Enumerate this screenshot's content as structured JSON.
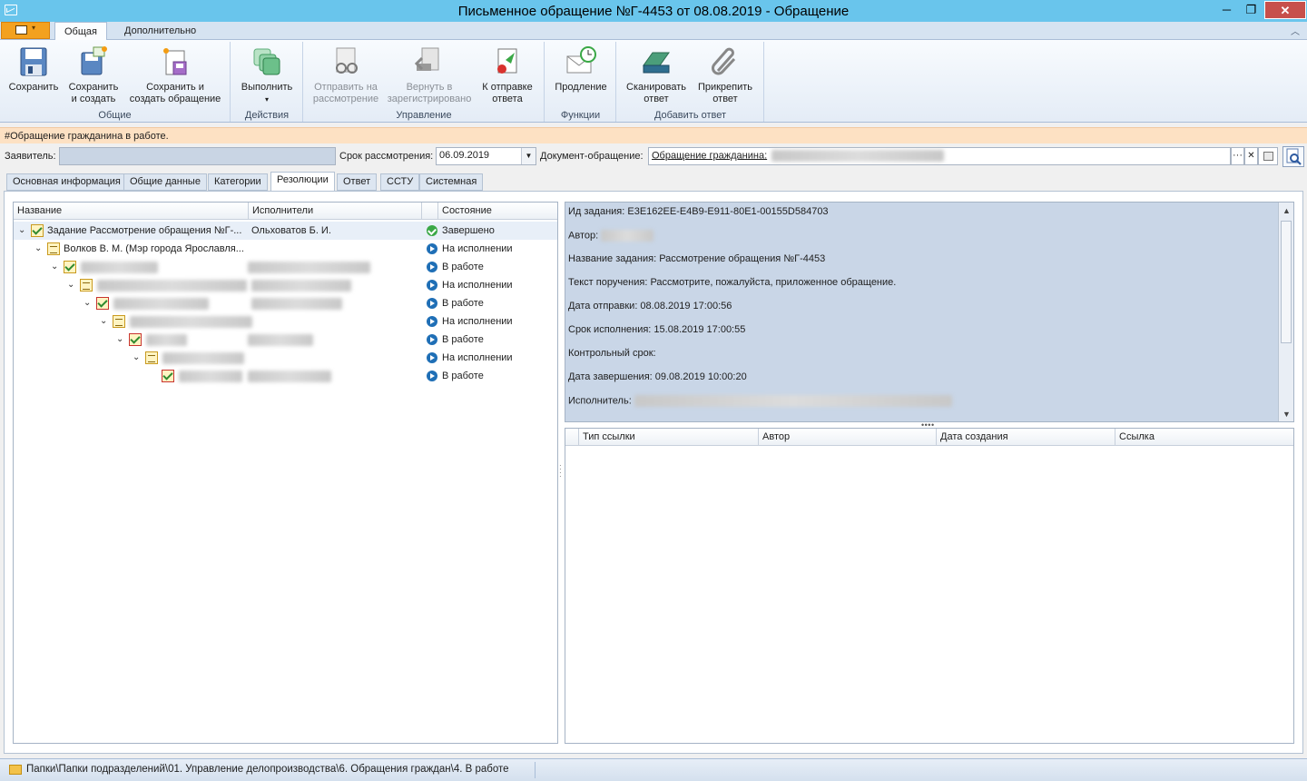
{
  "window": {
    "title": "Письменное обращение №Г-4453 от 08.08.2019 - Обращение",
    "minimize": "─",
    "maximize": "❐",
    "close": "✕"
  },
  "ribbon_tabs": [
    "Общая",
    "Дополнительно"
  ],
  "ribbon": {
    "groups": {
      "common": "Общие",
      "actions": "Действия",
      "management": "Управление",
      "functions": "Функции",
      "add_answer": "Добавить ответ"
    },
    "buttons": {
      "save": "Сохранить",
      "save_create_1": "Сохранить",
      "save_create_2": "и создать",
      "save_create_req_1": "Сохранить и",
      "save_create_req_2": "создать обращение",
      "execute": "Выполнить",
      "send_review_1": "Отправить на",
      "send_review_2": "рассмотрение",
      "return_1": "Вернуть в",
      "return_2": "зарегистрировано",
      "to_send_1": "К отправке",
      "to_send_2": "ответа",
      "extend": "Продление",
      "scan_1": "Сканировать",
      "scan_2": "ответ",
      "attach_1": "Прикрепить",
      "attach_2": "ответ"
    }
  },
  "infobar": "#Обращение гражданина в работе.",
  "fields": {
    "applicant_label": "Заявитель:",
    "deadline_label": "Срок рассмотрения:",
    "deadline_value": "06.09.2019",
    "doc_label": "Документ-обращение:",
    "doc_value": "Обращение гражданина:"
  },
  "doc_tabs": [
    "Основная информация",
    "Общие данные",
    "Категории",
    "Резолюции",
    "Ответ",
    "ССТУ",
    "Системная"
  ],
  "tree": {
    "columns": [
      "Название",
      "Исполнители",
      "Состояние"
    ],
    "rows": [
      {
        "name": "Задание Рассмотрение обращения №Г-...",
        "exec": "Ольховатов Б. И.",
        "status": "Завершено"
      },
      {
        "name": "Волков В. М. (Мэр города Ярославля...",
        "exec": "",
        "status": "На исполнении"
      },
      {
        "name": "",
        "exec": "",
        "status": "В работе"
      },
      {
        "name": "",
        "exec": "",
        "status": "На исполнении"
      },
      {
        "name": "",
        "exec": "",
        "status": "В работе"
      },
      {
        "name": "",
        "exec": "",
        "status": "На исполнении"
      },
      {
        "name": "",
        "exec": "",
        "status": "В работе"
      },
      {
        "name": "",
        "exec": "",
        "status": "На исполнении"
      },
      {
        "name": "",
        "exec": "",
        "status": "В работе"
      }
    ]
  },
  "detail": {
    "task_id": "Ид задания: E3E162EE-E4B9-E911-80E1-00155D584703",
    "author": "Автор:",
    "task_name": "Название задания: Рассмотрение обращения №Г-4453",
    "order_text": "Текст поручения: Рассмотрите, пожалуйста, приложенное обращение.",
    "sent_date": "Дата отправки: 08.08.2019 17:00:56",
    "due_date": "Срок исполнения: 15.08.2019 17:00:55",
    "control_date": "Контрольный срок:",
    "finish_date": "Дата завершения: 09.08.2019 10:00:20",
    "executor": "Исполнитель:"
  },
  "links_columns": [
    "Тип ссылки",
    "Автор",
    "Дата создания",
    "Ссылка"
  ],
  "statusbar": "Папки\\Папки подразделений\\01. Управление делопроизводства\\6. Обращения граждан\\4. В работе",
  "colors": {
    "titlebar": "#69c5ec",
    "infobar": "#fde1c3",
    "detail_bg": "#c9d6e7",
    "app_tab": "#f3a11f"
  }
}
